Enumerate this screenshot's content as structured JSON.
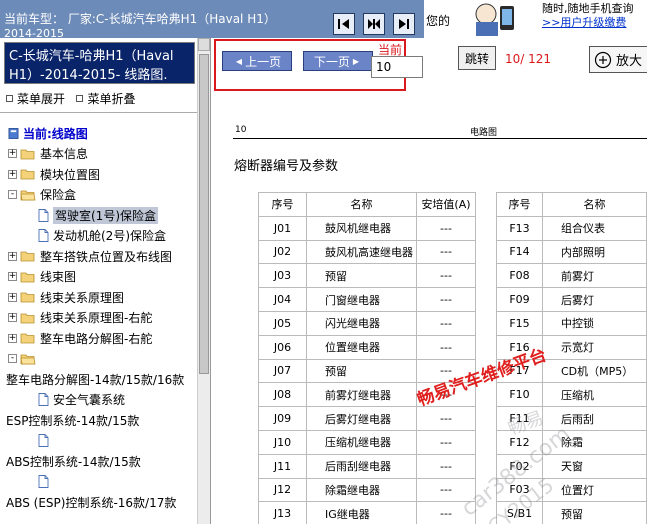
{
  "topbar": {
    "car_line": "当前车型：  厂家:C-长城汽车哈弗H1（Haval H1）",
    "year_line": "2014-2015",
    "cut_text": "您的",
    "promo_line1": "随时,随地手机查询",
    "promo_line2": ">>用户升级缴费",
    "icons": [
      "first-page-icon",
      "pause-icon",
      "next-page-icon",
      "mascot-icon"
    ]
  },
  "sidebar": {
    "model_line1": "C-长城汽车-哈弗H1（Haval",
    "model_line2": "H1）-2014-2015- 线路图.",
    "menu_expand": "菜单展开",
    "menu_collapse": "菜单折叠",
    "tree": [
      {
        "label": "当前:线路图",
        "kind": "current",
        "icon": "book-icon"
      },
      {
        "label": "基本信息",
        "kind": "folder",
        "expander": "+"
      },
      {
        "label": "模块位置图",
        "kind": "folder",
        "expander": "+"
      },
      {
        "label": "保险盒",
        "kind": "folder-open",
        "expander": "-"
      },
      {
        "label": "驾驶室(1号)保险盒",
        "kind": "doc-selected"
      },
      {
        "label": "发动机舱(2号)保险盒",
        "kind": "doc"
      },
      {
        "label": "整车搭铁点位置及布线图",
        "kind": "folder",
        "expander": "+"
      },
      {
        "label": "线束图",
        "kind": "folder",
        "expander": "+"
      },
      {
        "label": "线束关系原理图",
        "kind": "folder",
        "expander": "+"
      },
      {
        "label": "线束关系原理图-右舵",
        "kind": "folder",
        "expander": "+"
      },
      {
        "label": "整车电路分解图-右舵",
        "kind": "folder",
        "expander": "+"
      },
      {
        "label": "",
        "kind": "folder-open",
        "expander": "-"
      },
      {
        "label": "整车电路分解图-14款/15款/16款",
        "kind": "text"
      },
      {
        "label": "安全气囊系统",
        "kind": "doc"
      },
      {
        "label": "ESP控制系统-14款/15款",
        "kind": "text"
      },
      {
        "label": "",
        "kind": "doc"
      },
      {
        "label": "ABS控制系统-14款/15款",
        "kind": "text"
      },
      {
        "label": "",
        "kind": "doc"
      },
      {
        "label": "ABS (ESP)控制系统-16款/17款",
        "kind": "text"
      }
    ]
  },
  "toolbar": {
    "prev_label": "上一页",
    "next_label": "下一页",
    "current_label": "当前为",
    "page_value": "10",
    "jump_label": "跳转",
    "page_count": "10/ 121",
    "zoom_label": "放大"
  },
  "document": {
    "page_num": "10",
    "section": "电路图",
    "title": "熔断器编号及参数",
    "left_headers": [
      "序号",
      "名称",
      "安培值(A)"
    ],
    "left_rows": [
      [
        "J01",
        "鼓风机继电器",
        "---"
      ],
      [
        "J02",
        "鼓风机高速继电器",
        "---"
      ],
      [
        "J03",
        "预留",
        "---"
      ],
      [
        "J04",
        "门窗继电器",
        "---"
      ],
      [
        "J05",
        "闪光继电器",
        "---"
      ],
      [
        "J06",
        "位置继电器",
        "---"
      ],
      [
        "J07",
        "预留",
        "---"
      ],
      [
        "J08",
        "前雾灯继电器",
        "---"
      ],
      [
        "J09",
        "后雾灯继电器",
        "---"
      ],
      [
        "J10",
        "压缩机继电器",
        "---"
      ],
      [
        "J11",
        "后雨刮继电器",
        "---"
      ],
      [
        "J12",
        "除霜继电器",
        "---"
      ],
      [
        "J13",
        "IG继电器",
        "---"
      ]
    ],
    "right_headers": [
      "序号",
      "名称"
    ],
    "right_rows": [
      [
        "F13",
        "组合仪表"
      ],
      [
        "F14",
        "内部照明"
      ],
      [
        "F08",
        "前雾灯"
      ],
      [
        "F09",
        "后雾灯"
      ],
      [
        "F15",
        "中控锁"
      ],
      [
        "F16",
        "示宽灯"
      ],
      [
        "F17",
        "CD机（MP5）"
      ],
      [
        "F10",
        "压缩机"
      ],
      [
        "F11",
        "后雨刮"
      ],
      [
        "F12",
        "除霜"
      ],
      [
        "F02",
        "天窗"
      ],
      [
        "F03",
        "位置灯"
      ],
      [
        "S/B1",
        "预留"
      ]
    ]
  },
  "watermarks": {
    "main": "畅易汽车维修平台",
    "cn": "畅易",
    "url": "car388.com",
    "year": "CY2015"
  },
  "colors": {
    "topbar": "#6d8bb8",
    "selection": "#0a246a",
    "button": "#6b84c8",
    "highlight_red": "#d9191e",
    "link_blue": "#0033cc"
  }
}
